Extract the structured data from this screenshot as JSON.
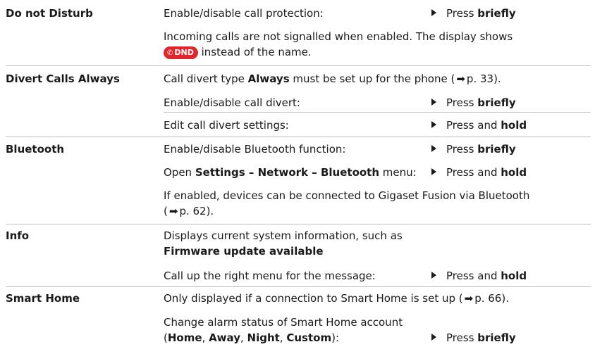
{
  "rows": {
    "dnd": {
      "label": "Do not Disturb",
      "desc1": "Enable/disable call protection:",
      "action_pre": "Press ",
      "action_bold": "briefly",
      "note_line1": "Incoming calls are not signalled when enabled. The display shows",
      "badge": "DND",
      "note_line2_post": " instead of the name."
    },
    "divert": {
      "label": "Divert Calls Always",
      "line1_pre": "Call divert type ",
      "line1_bold": "Always",
      "line1_post": " must be set up for the phone (",
      "line1_page": "p. 33).",
      "enable": "Enable/disable call divert:",
      "enable_action_pre": "Press ",
      "enable_action_bold": "briefly",
      "edit": "Edit call divert settings:",
      "edit_action_pre": "Press and ",
      "edit_action_bold": "hold"
    },
    "bluetooth": {
      "label": "Bluetooth",
      "enable": "Enable/disable Bluetooth function:",
      "enable_action_pre": "Press ",
      "enable_action_bold": "briefly",
      "open_pre": "Open ",
      "open_bold": "Settings – Network – Bluetooth",
      "open_post": " menu:",
      "open_action_pre": "Press and ",
      "open_action_bold": "hold",
      "note_line1": "If enabled, devices can be connected to Gigaset Fusion via Bluetooth",
      "note_page": "p. 62)."
    },
    "info": {
      "label": "Info",
      "line1": "Displays current system information, such as",
      "line2_bold": "Firmware update available",
      "callup": "Call up the right menu for the message:",
      "callup_action_pre": "Press and ",
      "callup_action_bold": "hold"
    },
    "smarthome": {
      "label": "Smart Home",
      "line1": "Only displayed if a connection to Smart Home is set up (",
      "line1_page": "p. 66).",
      "change": "Change alarm status of Smart Home account",
      "opts_open": "(",
      "opt_home": "Home",
      "sep1": ", ",
      "opt_away": "Away",
      "sep2": ", ",
      "opt_night": "Night",
      "sep3": ", ",
      "opt_custom": "Custom",
      "opts_close": "):",
      "change_action_pre": "Press ",
      "change_action_bold": "briefly"
    }
  },
  "icons": {
    "bullet": "triangle-right-icon",
    "page_ref": "arrow-right-icon",
    "badge_color": "#e0262d"
  }
}
